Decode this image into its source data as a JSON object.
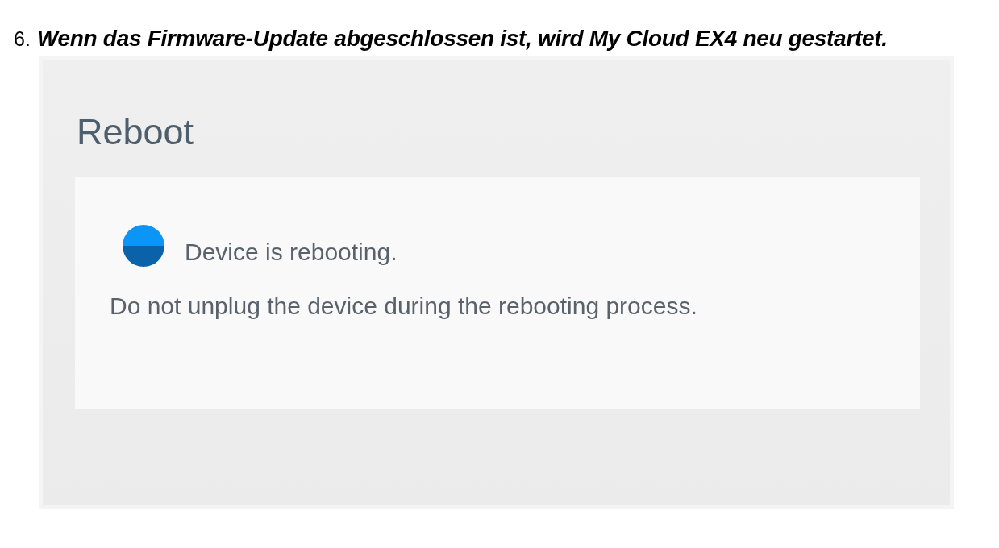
{
  "step": {
    "number": "6.",
    "text": "Wenn das Firmware-Update abgeschlossen ist, wird My Cloud EX4 neu gestartet."
  },
  "dialog": {
    "title": "Reboot",
    "status": "Device is rebooting.",
    "message": "Do not unplug the device during the rebooting process."
  }
}
